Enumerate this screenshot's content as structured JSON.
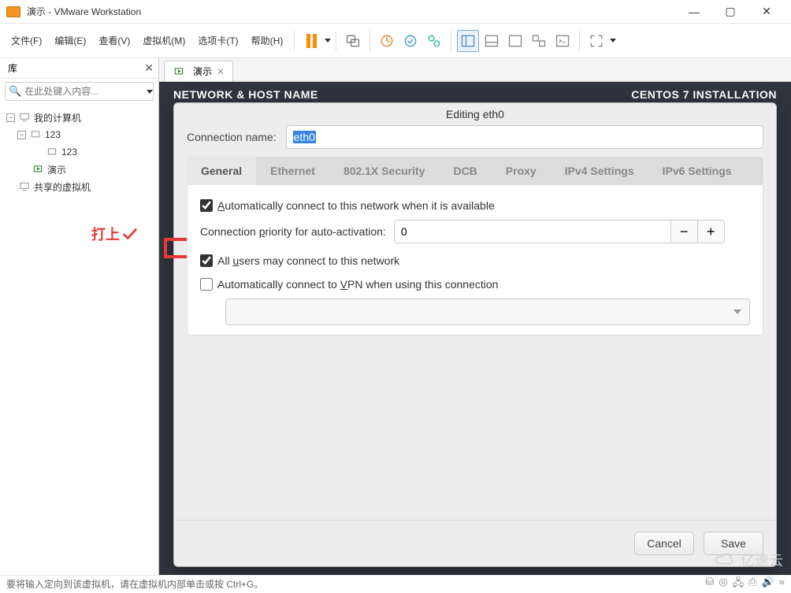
{
  "window": {
    "title": "演示 - VMware Workstation",
    "menu": {
      "file": "文件(F)",
      "edit": "编辑(E)",
      "view": "查看(V)",
      "vm": "虚拟机(M)",
      "tabs": "选项卡(T)",
      "help": "帮助(H)"
    }
  },
  "sidebar": {
    "title": "库",
    "search_placeholder": "在此处键入内容...",
    "tree": {
      "my_computer": "我的计算机",
      "n123a": "123",
      "n123b": "123",
      "demo": "演示",
      "shared": "共享的虚拟机"
    }
  },
  "tab": {
    "label": "演示"
  },
  "installer": {
    "left": "NETWORK & HOST NAME",
    "right": "CENTOS 7 INSTALLATION"
  },
  "dialog": {
    "title": "Editing eth0",
    "conn_label": "Connection name:",
    "conn_value": "eth0",
    "tabs": {
      "general": "General",
      "ethernet": "Ethernet",
      "security": "802.1X Security",
      "dcb": "DCB",
      "proxy": "Proxy",
      "ipv4": "IPv4 Settings",
      "ipv6": "IPv6 Settings"
    },
    "chk_auto": "Automatically connect to this network when it is available",
    "chk_auto_u": "A",
    "priority_label_pre": "Connection ",
    "priority_label_u": "p",
    "priority_label_post": "riority for auto-activation:",
    "priority_value": "0",
    "chk_users_pre": "All ",
    "chk_users_u": "u",
    "chk_users_post": "sers may connect to this network",
    "chk_vpn_pre": "Automatically connect to ",
    "chk_vpn_u": "V",
    "chk_vpn_post": "PN when using this connection",
    "cancel": "Cancel",
    "save": "Save",
    "save_u": "S",
    "cancel_u": "C"
  },
  "annotation": "打上",
  "statusbar": {
    "text": "要将输入定向到该虚拟机，请在虚拟机内部单击或按 Ctrl+G。"
  },
  "watermark": "亿速云"
}
